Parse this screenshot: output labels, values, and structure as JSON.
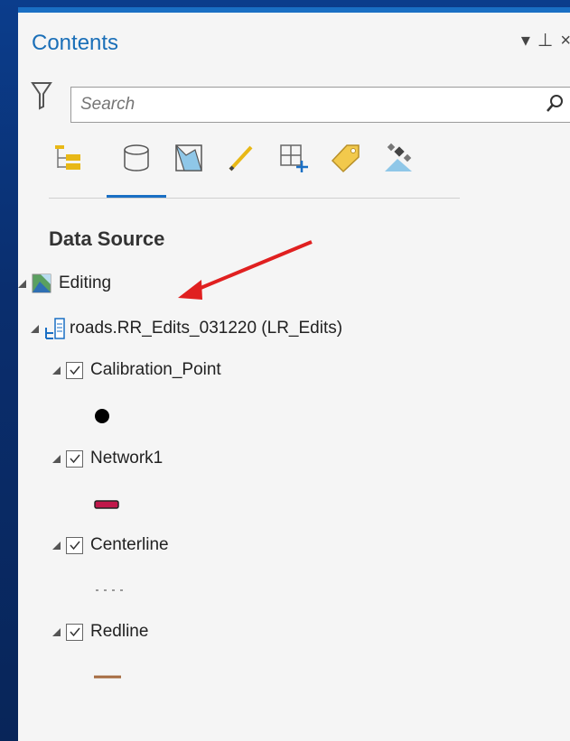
{
  "pane": {
    "title": "Contents",
    "window_controls": "▾ ⊥ ×"
  },
  "search": {
    "placeholder": "Search",
    "value": "Search"
  },
  "toolbar": {
    "buttons": [
      "list-by-drawing-order",
      "list-by-data-source",
      "list-by-selection",
      "list-by-editing",
      "list-by-snapping",
      "list-by-labeling",
      "list-by-perspective-imagery"
    ],
    "active": "list-by-data-source"
  },
  "section_title": "Data Source",
  "tree": {
    "map": "Editing",
    "workspace": "roads.RR_Edits_031220 (LR_Edits)",
    "layers": [
      {
        "name": "Calibration_Point",
        "checked": true,
        "symbol": "black-point"
      },
      {
        "name": "Network1",
        "checked": true,
        "symbol": "crimson-line"
      },
      {
        "name": "Centerline",
        "checked": true,
        "symbol": "dashed-line"
      },
      {
        "name": "Redline",
        "checked": true,
        "symbol": "brown-line"
      }
    ]
  },
  "colors": {
    "accent": "#1a6fc4",
    "annotation_arrow": "#e02020",
    "network_symbol": "#c0174a",
    "redline_symbol": "#a56a3f",
    "point_symbol": "#000000"
  }
}
